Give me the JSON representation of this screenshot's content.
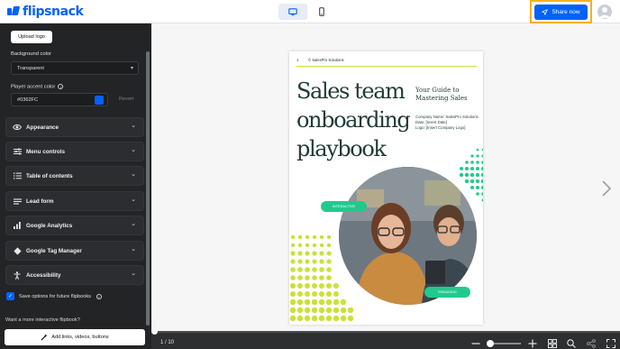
{
  "app": {
    "name": "flipsnack"
  },
  "topbar": {
    "share_label": "Share now"
  },
  "sidebar": {
    "upload_logo_label": "Upload logo",
    "background_color_label": "Background color",
    "background_color_value": "Transparent",
    "player_accent_label": "Player accent color",
    "player_accent_value": "#0362FC",
    "revert_label": "Revert",
    "panels": [
      {
        "label": "Appearance",
        "icon": "eye-icon"
      },
      {
        "label": "Menu controls",
        "icon": "sliders-icon"
      },
      {
        "label": "Table of contents",
        "icon": "list-icon"
      },
      {
        "label": "Lead form",
        "icon": "form-icon"
      },
      {
        "label": "Google Analytics",
        "icon": "bar-chart-icon"
      },
      {
        "label": "Google Tag Manager",
        "icon": "diamond-icon"
      },
      {
        "label": "Accessibility",
        "icon": "accessibility-icon"
      }
    ],
    "save_options_label": "Save options for future flipbooks",
    "want_more_text": "Want a more interactive flipbook?",
    "add_links_label": "Add links, videos, buttons"
  },
  "page": {
    "page_number": "1",
    "company_header": "© SalesPro Solutions",
    "headline_lines": [
      "Sales team",
      "onboarding",
      "playbook"
    ],
    "guide_lines": [
      "Your Guide to",
      "Mastering Sales"
    ],
    "meta_lines": [
      "Company Name: SalesPro Solutions",
      "Date: [Insert Date]",
      "Logo: [Insert Company Logo]"
    ],
    "pill_interactive": "INTERACTIVE",
    "pill_engaging": "ENGAGING"
  },
  "bottombar": {
    "page_count": "1 / 10"
  },
  "colors": {
    "accent": "#0362FC",
    "highlight": "#F2B21F",
    "sidebar_bg": "#222426",
    "heading_green": "#1F3B35",
    "lime": "#C9E236",
    "pill_green": "#22C98D"
  }
}
